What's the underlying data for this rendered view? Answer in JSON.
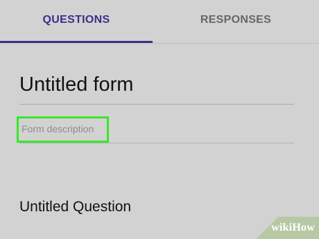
{
  "tabs": [
    {
      "label": "QUESTIONS",
      "active": true
    },
    {
      "label": "RESPONSES",
      "active": false
    }
  ],
  "form": {
    "title": "Untitled form",
    "description_placeholder": "Form description",
    "question_title": "Untitled Question"
  },
  "watermark": {
    "text": "wikiHow"
  },
  "colors": {
    "background": "#d2d2d2",
    "active_tab": "#3b2f86",
    "inactive_tab": "#666666",
    "highlight": "#39e62a",
    "watermark_bg": "#b7c9a4"
  }
}
